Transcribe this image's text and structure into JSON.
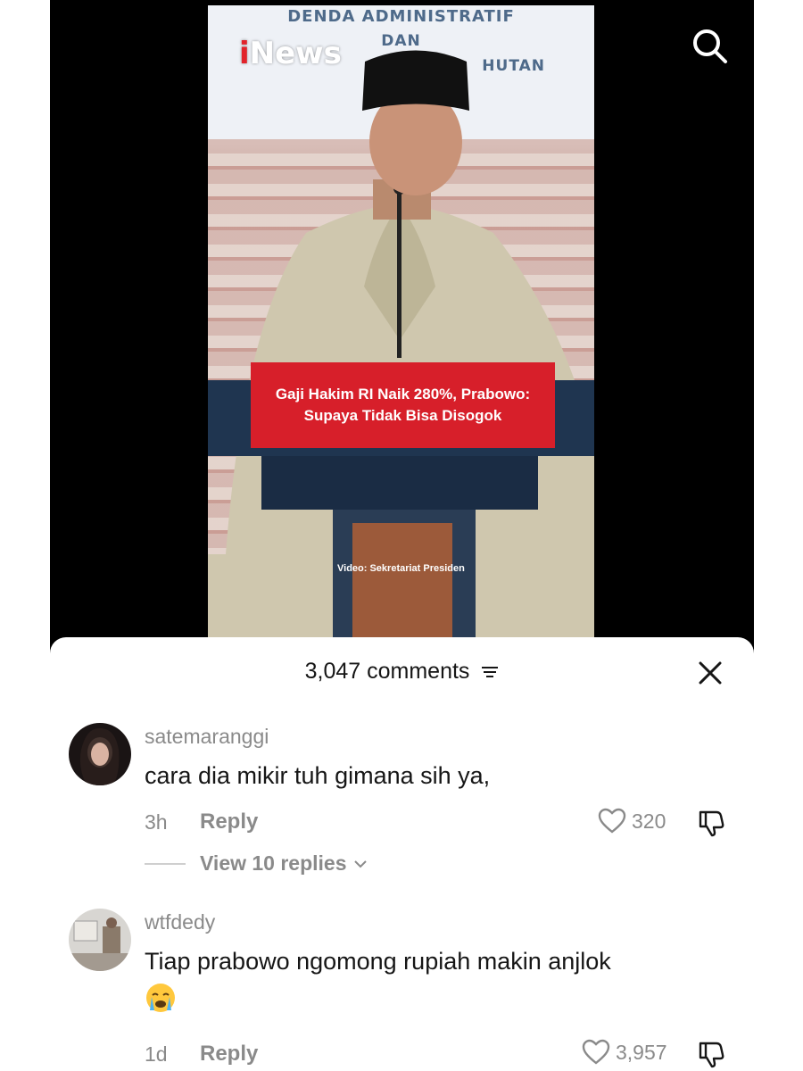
{
  "video": {
    "brand_logo": "iNews",
    "backdrop_lines": [
      "DENDA ADMINISTRATIF",
      "DAN",
      "HUTAN"
    ],
    "headline": "Gaji Hakim RI Naik 280%, Prabowo: Supaya Tidak Bisa Disogok",
    "credit": "Video: Sekretariat Presiden",
    "search_icon": "search-icon"
  },
  "comments_panel": {
    "count_label": "3,047 comments",
    "filter_icon": "filter-icon",
    "close_icon": "close-icon"
  },
  "comments": [
    {
      "username": "satemaranggi",
      "text": "cara dia mikir tuh gimana sih ya,",
      "time": "3h",
      "reply_label": "Reply",
      "likes": "320",
      "view_replies": "View 10 replies"
    },
    {
      "username": "wtfdedy",
      "text": "Tiap prabowo ngomong rupiah makin anjlok",
      "emoji": "crying-face",
      "time": "1d",
      "reply_label": "Reply",
      "likes": "3,957"
    }
  ],
  "colors": {
    "banner_red": "#d71f2a",
    "muted_gray": "#8a8a8a",
    "text_dark": "#161616"
  }
}
